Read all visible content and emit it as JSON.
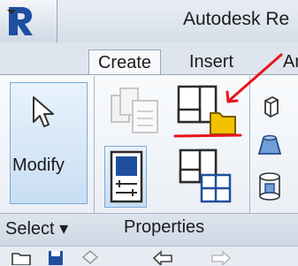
{
  "app": {
    "title": "Autodesk Re"
  },
  "tabs": {
    "create": "Create",
    "insert": "Insert",
    "annotate": "Ar"
  },
  "panels": {
    "select": {
      "label": "Select ▾"
    },
    "properties": {
      "label": "Properties"
    }
  },
  "buttons": {
    "modify_label": "Modify"
  },
  "icons": {
    "app_menu": "revit-r-icon",
    "cursor": "cursor-arrow-icon",
    "type_properties": "type-properties-icon",
    "family_type": "family-folder-icon",
    "properties": "properties-palette-icon",
    "type_selector": "type-selector-grid-icon"
  },
  "annotation": {
    "color": "#e8141c"
  },
  "colors": {
    "accent": "#1e4f9e",
    "folder": "#f2c200",
    "ribbon_highlight": "#c9def3"
  }
}
